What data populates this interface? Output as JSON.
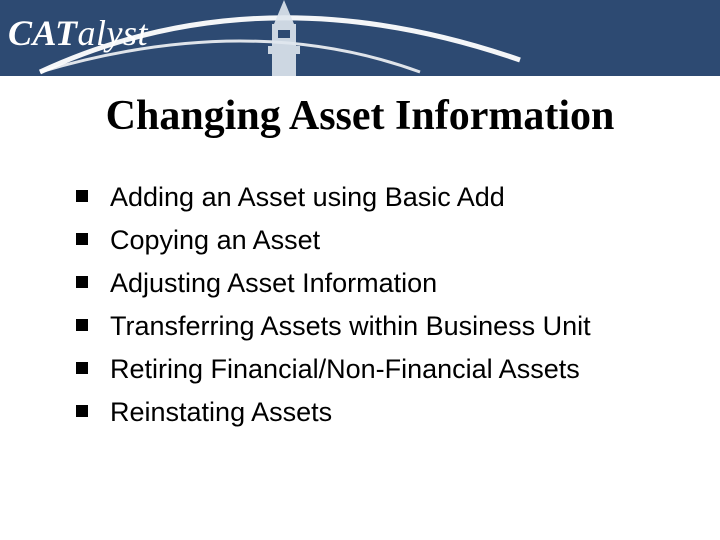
{
  "header": {
    "logo_cat": "CAT",
    "logo_alyst": "alyst"
  },
  "title": "Changing Asset Information",
  "bullets": [
    "Adding an Asset using Basic Add",
    "Copying an Asset",
    "Adjusting Asset Information",
    "Transferring Assets within Business Unit",
    "Retiring Financial/Non-Financial Assets",
    "Reinstating Assets"
  ]
}
